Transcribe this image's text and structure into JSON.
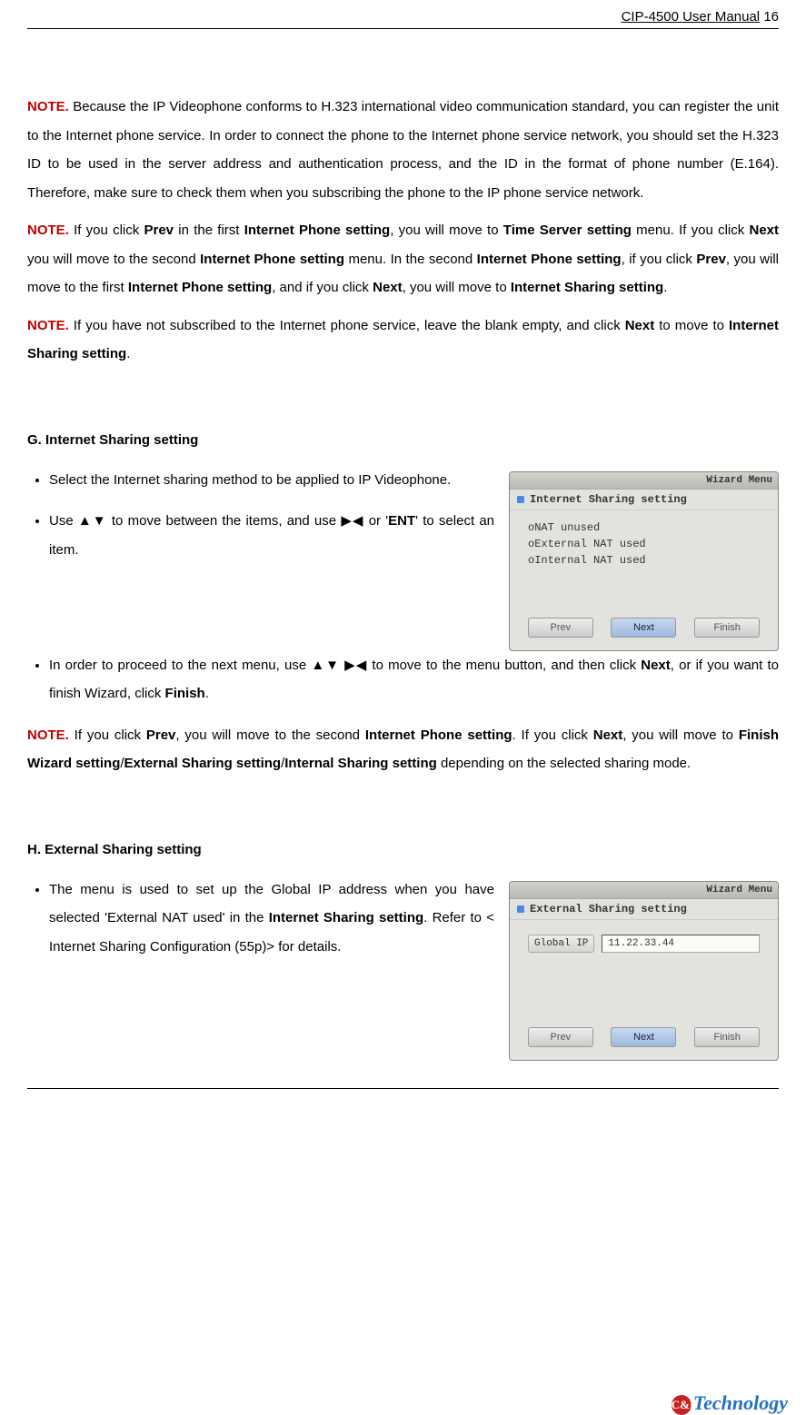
{
  "header": {
    "title": "CIP-4500 User Manual",
    "page_no": "16"
  },
  "note1": {
    "label": "NOTE.",
    "text": " Because the IP Videophone conforms to H.323 international video communication standard, you can register the unit to the Internet phone service. In order to connect the phone to the Internet phone service network, you should set the H.323 ID to be used in the server address and authentication process, and the ID in the format of phone number (E.164). Therefore, make sure to check them when you subscribing the phone to the IP phone service network."
  },
  "note2": {
    "label": "NOTE.",
    "t1": " If you click ",
    "b1": "Prev",
    "t2": " in the first ",
    "b2": "Internet Phone setting",
    "t3": ", you will move to ",
    "b3": "Time Server setting",
    "t4": " menu. If you click ",
    "b4": "Next",
    "t5": " you will move to the second ",
    "b5": "Internet Phone setting",
    "t6": " menu. In the second ",
    "b6": "Internet Phone setting",
    "t7": ", if you click ",
    "b7": "Prev",
    "t8": ", you will move to the first ",
    "b8": "Internet Phone setting",
    "t9": ", and if you click ",
    "b9": "Next",
    "t10": ", you will move to ",
    "b10": "Internet Sharing setting",
    "t11": "."
  },
  "note3": {
    "label": "NOTE.",
    "t1": " If you have not subscribed to the Internet phone service, leave the blank empty, and click ",
    "b1": "Next",
    "t2": " to move to ",
    "b2": "Internet Sharing setting",
    "t3": "."
  },
  "sectionG": {
    "title": "G. Internet Sharing setting",
    "li1": "Select the Internet sharing method to be applied to IP Videophone.",
    "li2": {
      "t1": "Use ▲▼ to move between the items, and use ▶◀ or '",
      "b1": "ENT",
      "t2": "' to select an item."
    },
    "li3": {
      "t1": "In order to proceed to the next menu, use ▲▼ ▶◀ to move to the menu button, and then click ",
      "b1": "Next",
      "t2": ", or if you want to finish Wizard, click ",
      "b2": "Finish",
      "t3": "."
    },
    "shot": {
      "menu": "Wizard Menu",
      "heading": "Internet Sharing setting",
      "opt1": "oNAT unused",
      "opt2": "oExternal NAT used",
      "opt3": "oInternal NAT used",
      "btn_prev": "Prev",
      "btn_next": "Next",
      "btn_finish": "Finish"
    },
    "note": {
      "label": "NOTE.",
      "t1": " If you click ",
      "b1": "Prev",
      "t2": ", you will move to the second ",
      "b2": "Internet Phone setting",
      "t3": ". If you click ",
      "b3": "Next",
      "t4": ", you will move to ",
      "b4": "Finish Wizard setting",
      "t5": "/",
      "b5": "External Sharing setting",
      "t6": "/",
      "b6": "Internal Sharing setting",
      "t7": " depending on the selected sharing mode."
    }
  },
  "sectionH": {
    "title": "H. External Sharing setting",
    "li1": {
      "t1": "The menu is used to set up the Global IP address when you have selected 'External NAT used' in the ",
      "b1": "Internet Sharing setting",
      "t2": ". Refer to < Internet Sharing Configuration (55p)> for details."
    },
    "shot": {
      "menu": "Wizard Menu",
      "heading": "External Sharing setting",
      "label": "Global IP",
      "value": "11.22.33.44",
      "btn_prev": "Prev",
      "btn_next": "Next",
      "btn_finish": "Finish"
    }
  },
  "logo": {
    "icon": "C&I",
    "text": "Technology"
  }
}
